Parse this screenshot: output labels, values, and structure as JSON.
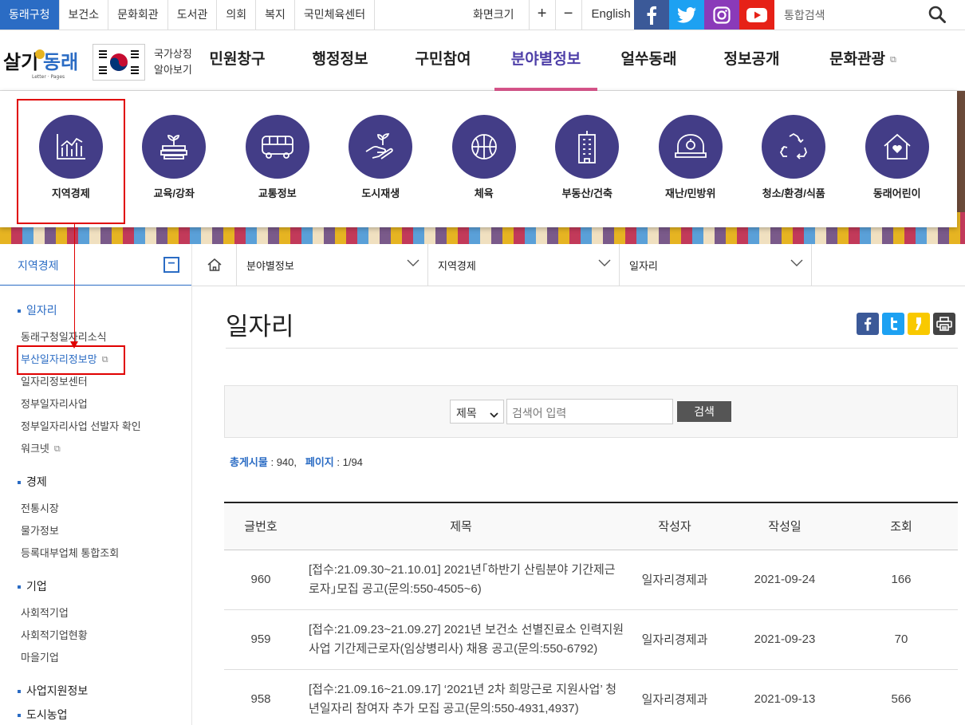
{
  "top_links": [
    "동래구청",
    "보건소",
    "문화회관",
    "도서관",
    "의회",
    "복지",
    "국민체육센터"
  ],
  "font_size": {
    "label": "화면크기",
    "plus": "+",
    "minus": "−"
  },
  "english": "English",
  "top_search": {
    "placeholder": "통합검색"
  },
  "logo": {
    "text": "살기좋은동래"
  },
  "symbol": {
    "line1": "국가상징",
    "line2": "알아보기"
  },
  "gnb": [
    "민원창구",
    "행정정보",
    "구민참여",
    "분야별정보",
    "얼쑤동래",
    "정보공개",
    "문화관광"
  ],
  "mega_menu": [
    {
      "label": "지역경제",
      "icon": "chart-icon"
    },
    {
      "label": "교육/강좌",
      "icon": "education-icon"
    },
    {
      "label": "교통정보",
      "icon": "bus-icon"
    },
    {
      "label": "도시재생",
      "icon": "sprout-hand-icon"
    },
    {
      "label": "체육",
      "icon": "ball-icon"
    },
    {
      "label": "부동산/건축",
      "icon": "building-icon"
    },
    {
      "label": "재난/민방위",
      "icon": "helmet-icon"
    },
    {
      "label": "청소/환경/식품",
      "icon": "recycle-icon"
    },
    {
      "label": "동래어린이",
      "icon": "house-heart-icon"
    }
  ],
  "lnb": {
    "title": "지역경제",
    "groups": [
      {
        "label": "일자리",
        "items": [
          "동래구청일자리소식",
          "부산일자리정보망",
          "일자리정보센터",
          "정부일자리사업",
          "정부일자리사업 선발자 확인",
          "워크넷"
        ]
      },
      {
        "label": "경제",
        "items": [
          "전통시장",
          "물가정보",
          "등록대부업체 통합조회"
        ]
      },
      {
        "label": "기업",
        "items": [
          "사회적기업",
          "사회적기업현황",
          "마을기업"
        ]
      },
      {
        "label": "사업지원정보",
        "items": []
      },
      {
        "label": "도시농업",
        "items": []
      }
    ]
  },
  "location": [
    "분야별정보",
    "지역경제",
    "일자리"
  ],
  "page_title": "일자리",
  "search": {
    "option": "제목",
    "placeholder": "검색어 입력",
    "button": "검색"
  },
  "totals": {
    "label1": "총게시물",
    "value1": "940,",
    "label2": "페이지",
    "value2": "1/94"
  },
  "table": {
    "headers": [
      "글번호",
      "제목",
      "작성자",
      "작성일",
      "조회"
    ],
    "rows": [
      {
        "no": "960",
        "title": "[접수:21.09.30~21.10.01] 2021년｢하반기 산림분야 기간제근로자｣모집 공고(문의:550-4505~6)",
        "author": "일자리경제과",
        "date": "2021-09-24",
        "views": "166"
      },
      {
        "no": "959",
        "title": "[접수:21.09.23~21.09.27] 2021년 보건소 선별진료소 인력지원사업 기간제근로자(임상병리사) 채용 공고(문의:550-6792)",
        "author": "일자리경제과",
        "date": "2021-09-23",
        "views": "70"
      },
      {
        "no": "958",
        "title": "[접수:21.09.16~21.09.17] ‘2021년 2차 희망근로 지원사업’ 청년일자리 참여자 추가 모집 공고(문의:550-4931,4937)",
        "author": "일자리경제과",
        "date": "2021-09-13",
        "views": "566"
      }
    ]
  },
  "colors": {
    "brand": "#433d87",
    "link_blue": "#2b6cc4",
    "active_pink": "#d9558b",
    "annotation_red": "#e00000"
  }
}
